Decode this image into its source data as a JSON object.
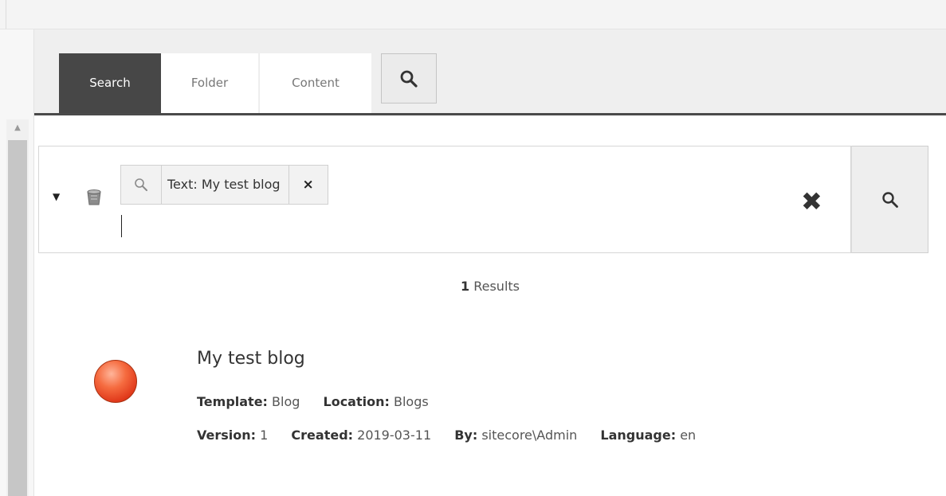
{
  "tabs": [
    {
      "label": "Search",
      "active": true
    },
    {
      "label": "Folder",
      "active": false
    },
    {
      "label": "Content",
      "active": false
    }
  ],
  "search": {
    "chip": {
      "label": "Text:  My test blog",
      "remove": "×"
    },
    "clear": "✖",
    "input_value": ""
  },
  "results": {
    "count": "1",
    "count_suffix": " Results",
    "items": [
      {
        "title": "My test blog",
        "template_key": "Template:",
        "template": " Blog",
        "location_key": "Location:",
        "location": " Blogs",
        "version_key": "Version:",
        "version": " 1",
        "created_key": "Created:",
        "created": " 2019-03-11",
        "by_key": "By:",
        "by": " sitecore\\Admin",
        "language_key": "Language:",
        "language": " en",
        "icon": "red-circle-icon"
      }
    ]
  },
  "colors": {
    "active_tab": "#474747",
    "status_icon": "#e0381a"
  },
  "icons": {
    "tab_search": "search-icon",
    "chip": "search-icon",
    "go": "search-icon",
    "filter": "caret-down-icon",
    "database": "database-icon",
    "clear": "close-icon"
  }
}
